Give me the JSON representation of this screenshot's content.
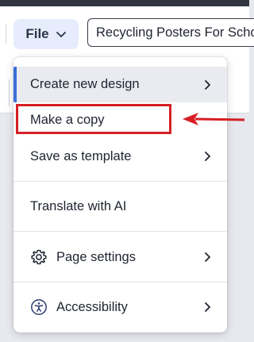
{
  "toolbar": {
    "file_label": "File",
    "document_title": "Recycling Posters For School",
    "partial_label": "s"
  },
  "menu": {
    "items": [
      {
        "label": "Create new design",
        "has_submenu": true,
        "icon": null
      },
      {
        "label": "Make a copy",
        "has_submenu": false,
        "icon": null
      },
      {
        "label": "Save as template",
        "has_submenu": true,
        "icon": null
      },
      {
        "label": "Translate with AI",
        "has_submenu": false,
        "icon": null
      },
      {
        "label": "Page settings",
        "has_submenu": true,
        "icon": "gear-icon"
      },
      {
        "label": "Accessibility",
        "has_submenu": true,
        "icon": "accessibility-icon"
      }
    ]
  },
  "annotation": {
    "highlight_color": "#d51f25",
    "target": "Make a copy"
  },
  "colors": {
    "accent": "#3b6fd8",
    "file_button_bg": "#e6ecfb",
    "active_item_bg": "#e9ebf0"
  }
}
